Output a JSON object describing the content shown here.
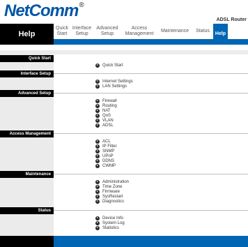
{
  "brand": {
    "logo": "NetComm",
    "reg": "®",
    "model": "ADSL Router"
  },
  "help_title": "Help",
  "tabs": [
    {
      "label": "Quick Start"
    },
    {
      "label": "Interface Setup"
    },
    {
      "label": "Advanced Setup"
    },
    {
      "label": "Access Management"
    },
    {
      "label": "Maintenance"
    },
    {
      "label": "Status"
    },
    {
      "label": "Help"
    }
  ],
  "sections": [
    {
      "title": "Quick Start",
      "links": [
        "Quick Start"
      ]
    },
    {
      "title": "Interface Setup",
      "links": [
        "Internet Settings",
        "LAN Settings"
      ]
    },
    {
      "title": "Advanced Setup",
      "links": [
        "Firewall",
        "Routing",
        "NAT",
        "QoS",
        "VLAN",
        "ADSL"
      ]
    },
    {
      "title": "Access Management",
      "links": [
        "ACL",
        "IP Filter",
        "SNMP",
        "UPnP",
        "DDNS",
        "CWMP"
      ]
    },
    {
      "title": "Maintenance",
      "links": [
        "Administration",
        "Time Zone",
        "Firmware",
        "SysRestart",
        "Diagnostics"
      ]
    },
    {
      "title": "Status",
      "links": [
        "Device Info",
        "System Log",
        "Statistics"
      ]
    }
  ]
}
